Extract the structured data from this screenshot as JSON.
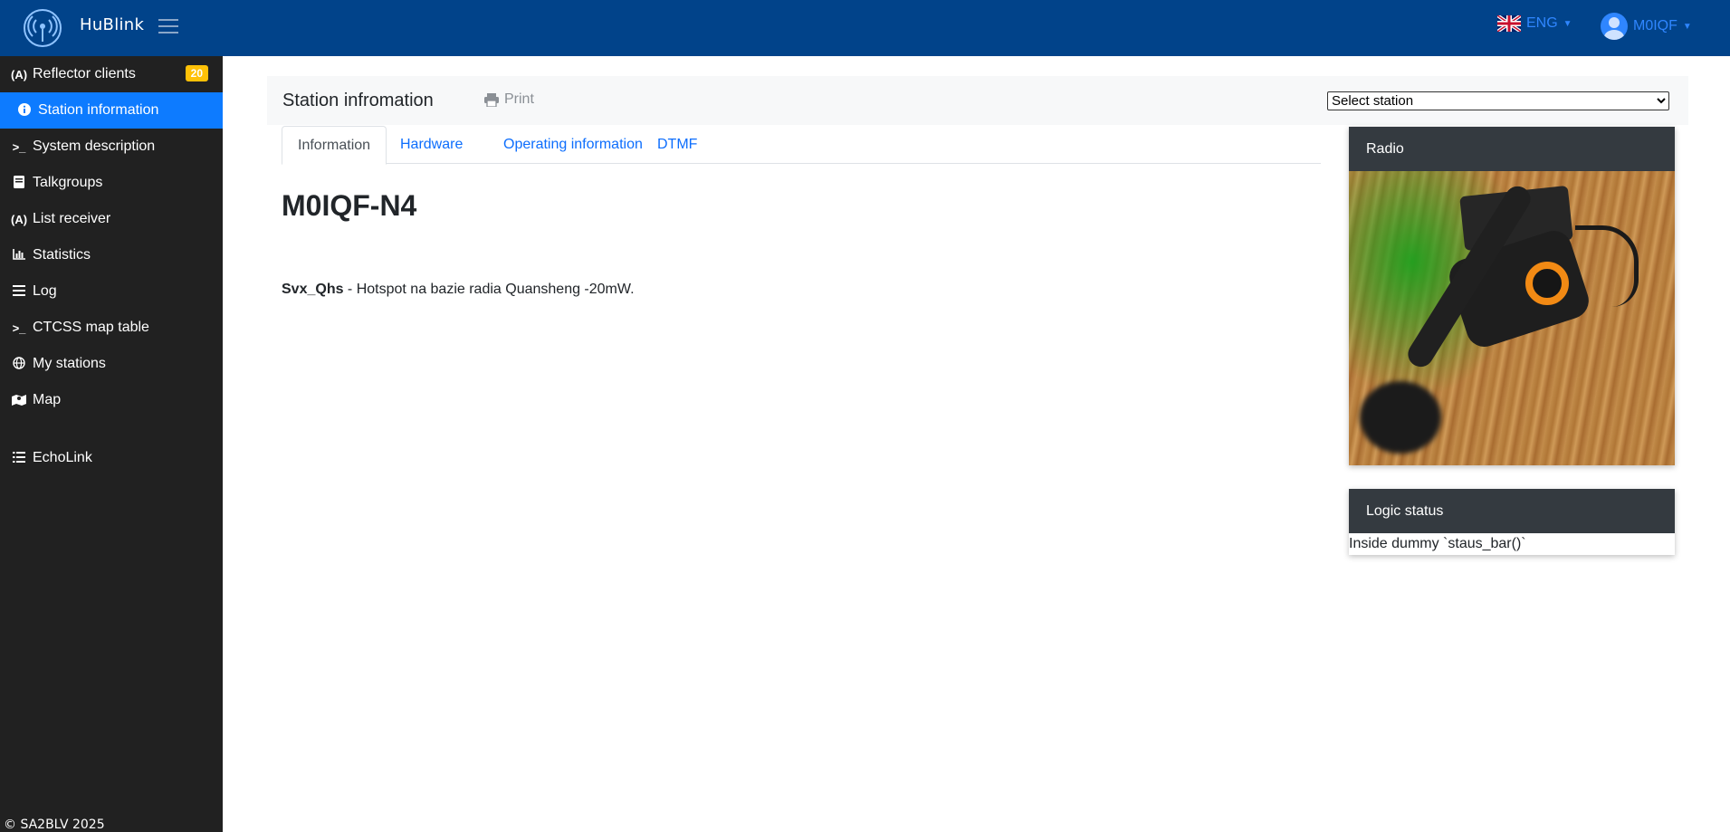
{
  "app": {
    "brand": "HuBlink"
  },
  "topbar": {
    "language": "ENG",
    "user": "M0IQF",
    "flag_icon": "uk-flag-icon",
    "colors": {
      "bar": "#01438a",
      "link": "#2f86ff"
    }
  },
  "sidebar": {
    "items": [
      {
        "label": "Reflector clients",
        "icon": "antenna-icon",
        "badge": "20"
      },
      {
        "label": "Station information",
        "icon": "info-icon"
      },
      {
        "label": "System description",
        "icon": "terminal-icon"
      },
      {
        "label": "Talkgroups",
        "icon": "book-icon"
      },
      {
        "label": "List receiver",
        "icon": "antenna-icon"
      },
      {
        "label": "Statistics",
        "icon": "bar-chart-icon"
      },
      {
        "label": "Log",
        "icon": "list-icon"
      },
      {
        "label": "CTCSS map table",
        "icon": "terminal-icon"
      },
      {
        "label": "My stations",
        "icon": "globe-icon"
      },
      {
        "label": "Map",
        "icon": "map-icon"
      },
      {
        "label": "EchoLink",
        "icon": "list-ul-icon"
      }
    ],
    "active": "Station information",
    "copyright": "© SA2BLV 2025",
    "colors": {
      "bg": "#212121",
      "active": "#0d7bff",
      "badge": "#ffc107"
    }
  },
  "header": {
    "title": "Station infromation",
    "print_label": "Print",
    "station_select": {
      "value": "Select station",
      "options": [
        "Select station"
      ]
    }
  },
  "tabs": [
    {
      "label": "Information",
      "active": true
    },
    {
      "label": "Hardware"
    },
    {
      "label": "Operating information"
    },
    {
      "label": "DTMF"
    }
  ],
  "station": {
    "callsign": "M0IQF-N4",
    "description_name": "Svx_Qhs",
    "description_text": " - Hotspot na bazie radia Quansheng  -20mW."
  },
  "cards": {
    "radio": {
      "title": "Radio"
    },
    "logic": {
      "title": "Logic status",
      "body": "Inside dummy `staus_bar()`"
    }
  }
}
